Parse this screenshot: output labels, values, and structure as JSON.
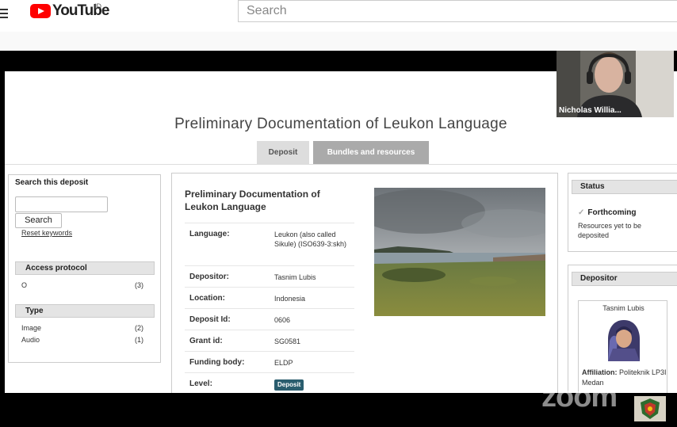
{
  "youtube": {
    "brand": "YouTube",
    "country_code": "ID",
    "search_placeholder": "Search"
  },
  "page": {
    "title": "Preliminary Documentation of Leukon Language",
    "tabs": [
      "Deposit",
      "Bundles and resources"
    ]
  },
  "search_panel": {
    "title": "Search this deposit",
    "button_label": "Search",
    "reset_label": "Reset keywords",
    "facets": [
      {
        "title": "Access protocol",
        "items": [
          {
            "label": "O",
            "count": "(3)"
          }
        ]
      },
      {
        "title": "Type",
        "items": [
          {
            "label": "Image",
            "count": "(2)"
          },
          {
            "label": "Audio",
            "count": "(1)"
          }
        ]
      }
    ]
  },
  "deposit": {
    "title": "Preliminary Documentation of Leukon Language",
    "fields": [
      {
        "key": "Language:",
        "value": "Leukon (also called Sikule) (ISO639-3:skh)"
      },
      {
        "key": "Depositor:",
        "value": "Tasnim Lubis"
      },
      {
        "key": "Location:",
        "value": "Indonesia"
      },
      {
        "key": "Deposit Id:",
        "value": "0606"
      },
      {
        "key": "Grant id:",
        "value": "SG0581"
      },
      {
        "key": "Funding body:",
        "value": "ELDP"
      },
      {
        "key": "Level:",
        "value": "Deposit"
      }
    ]
  },
  "status_panel": {
    "title": "Status",
    "status": "Forthcoming",
    "note": "Resources yet to be deposited"
  },
  "depositor_panel": {
    "title": "Depositor",
    "name": "Tasnim Lubis",
    "affiliation_label": "Affiliation:",
    "affiliation": "Politeknik LP3I Medan"
  },
  "webcam": {
    "participant_name": "Nicholas Willia..."
  },
  "zoom_watermark": "zoom",
  "colors": {
    "youtube_red": "#ff0000",
    "level_badge": "#2a5d6e",
    "tab_active": "#dddddd",
    "tab_inactive": "#aaaaaa"
  }
}
